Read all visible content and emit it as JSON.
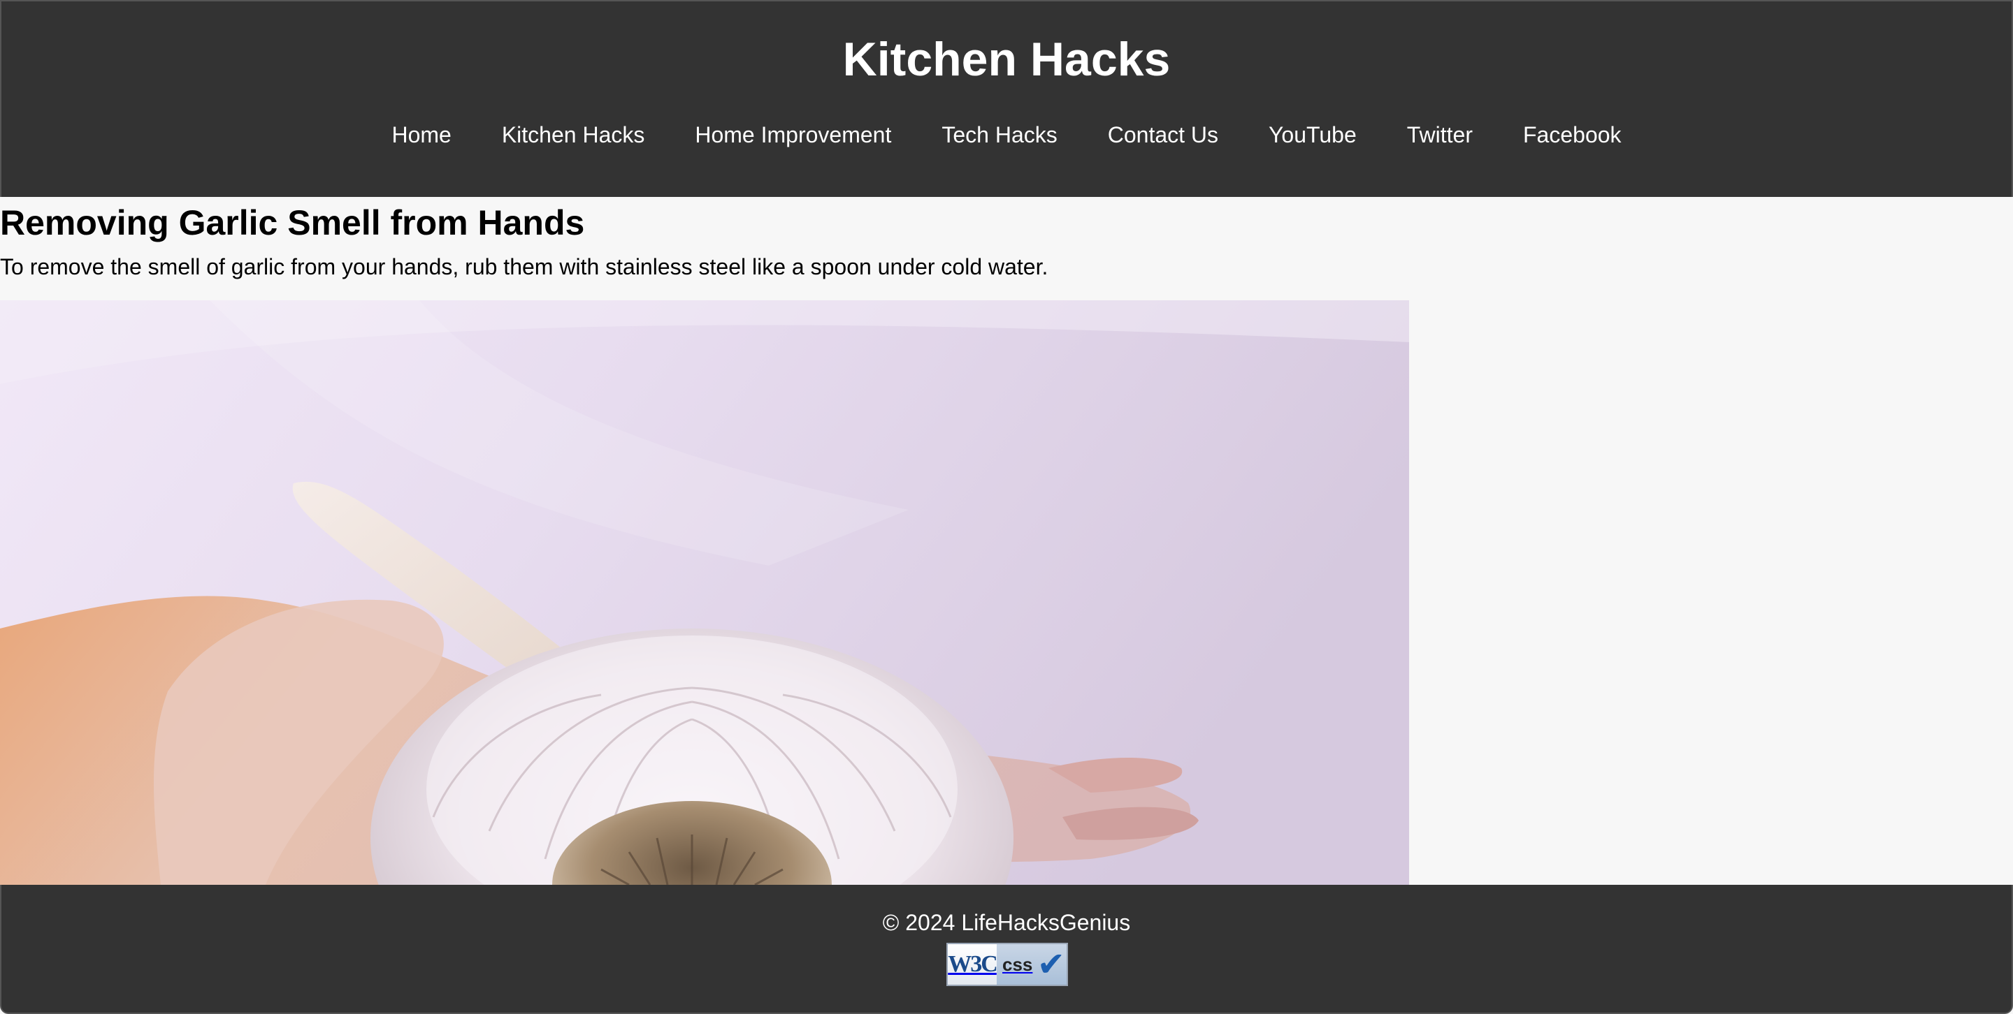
{
  "header": {
    "title": "Kitchen Hacks",
    "nav": [
      {
        "label": "Home"
      },
      {
        "label": "Kitchen Hacks"
      },
      {
        "label": "Home Improvement"
      },
      {
        "label": "Tech Hacks"
      },
      {
        "label": "Contact Us"
      },
      {
        "label": "YouTube"
      },
      {
        "label": "Twitter"
      },
      {
        "label": "Facebook"
      }
    ]
  },
  "article": {
    "title": "Removing Garlic Smell from Hands",
    "text": "To remove the smell of garlic from your hands, rub them with stainless steel like a spoon under cold water.",
    "image_subject": "garlic-bulb-in-hand"
  },
  "footer": {
    "copyright": "© 2024 LifeHacksGenius",
    "badge": {
      "w3c_text": "W3C",
      "css_text": "css",
      "check": "✔"
    }
  },
  "colors": {
    "header_bg": "#333333",
    "footer_bg": "#333333",
    "page_bg": "#f7f7f7",
    "text_light": "#ffffff"
  }
}
